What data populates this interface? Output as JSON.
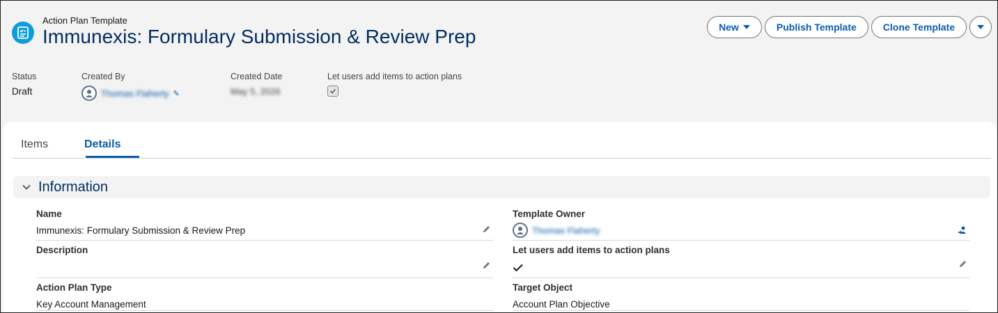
{
  "header": {
    "object_type": "Action Plan Template",
    "title": "Immunexis: Formulary Submission & Review Prep",
    "icon": "checklist-icon"
  },
  "actions": {
    "new_label": "New",
    "publish_label": "Publish Template",
    "clone_label": "Clone Template",
    "more": "chevron-down-icon"
  },
  "highlights": {
    "status_label": "Status",
    "status_value": "Draft",
    "created_by_label": "Created By",
    "created_by_value": "Thomas Flaherty",
    "created_date_label": "Created Date",
    "created_date_value": "May 5, 2026",
    "let_users_label": "Let users add items to action plans",
    "let_users_checked": true
  },
  "tabs": [
    {
      "label": "Items",
      "active": false
    },
    {
      "label": "Details",
      "active": true
    }
  ],
  "section": {
    "title": "Information",
    "expanded": true
  },
  "fields": {
    "name_label": "Name",
    "name_value": "Immunexis: Formulary Submission & Review Prep",
    "description_label": "Description",
    "description_value": "",
    "plan_type_label": "Action Plan Type",
    "plan_type_value": "Key Account Management",
    "owner_label": "Template Owner",
    "owner_value": "Thomas Flaherty",
    "let_users_label": "Let users add items to action plans",
    "let_users_value": true,
    "target_label": "Target Object",
    "target_value": "Account Plan Objective"
  },
  "colors": {
    "brand": "#0b5cab",
    "title": "#032d60",
    "icon_bg": "#0d9dda"
  }
}
